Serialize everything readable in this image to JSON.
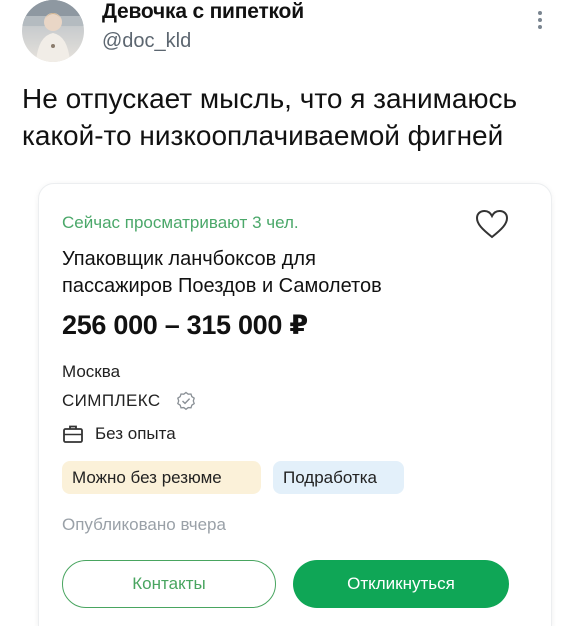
{
  "tweet": {
    "author_name": "Девочка с пипеткой",
    "author_handle": "@doc_kld",
    "text_lines": [
      "Не отпускает мысль, что я занимаюсь",
      "какой-то низкооплачиваемой фигней"
    ]
  },
  "vacancy_card": {
    "viewing_now": "Сейчас просматривают 3 чел.",
    "title_lines": [
      "Упаковщик ланчбоксов для",
      "пассажиров Поездов и Самолетов"
    ],
    "salary": "256 000 – 315 000 ₽",
    "city": "Москва",
    "company": "СИМПЛЕКС",
    "experience": "Без опыта",
    "tags": [
      "Можно без резюме",
      "Подработка"
    ],
    "published": "Опубликовано вчера",
    "contacts_button": "Контакты",
    "respond_button": "Откликнуться"
  },
  "colors": {
    "accent_green": "#0fa656",
    "viewing_text": "#4ba86a",
    "tag_resume_bg": "#fbf1d9",
    "tag_parttime_bg": "#e3f0fa"
  },
  "icons": {
    "more": "more-vertical-icon",
    "favorite": "heart-icon",
    "verified": "verified-check-icon",
    "experience": "briefcase-icon"
  }
}
